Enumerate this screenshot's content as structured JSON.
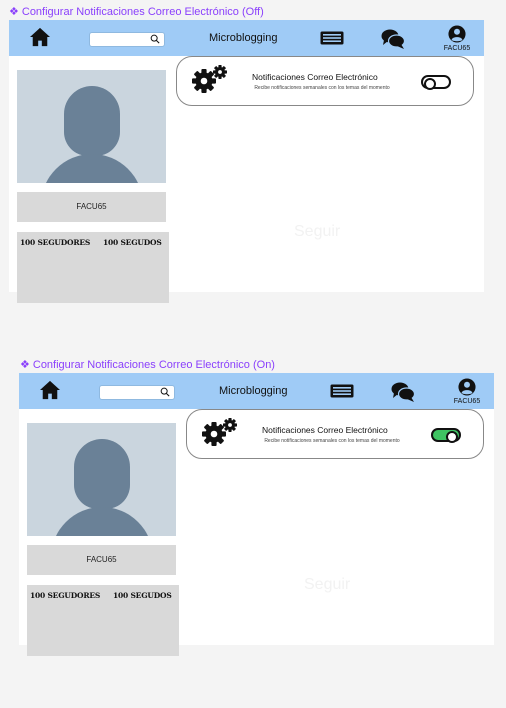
{
  "frames": [
    {
      "title": "Configurar Notificaciones Correo Electrónico (Off)",
      "app": {
        "search_placeholder": "",
        "brand": "Microblogging",
        "username": "FACU65"
      },
      "profile": {
        "username": "FACU65",
        "followers_label": "100 SEGUDORES",
        "following_label": "100 SEGUDOS",
        "follow_label": "Seguir"
      },
      "notification": {
        "title": "Notificaciones Correo Electrónico",
        "description": "Recibe notificaciones semanales con los temas del momento",
        "enabled": false
      }
    },
    {
      "title": "Configurar Notificaciones Correo Electrónico (On)",
      "app": {
        "search_placeholder": "",
        "brand": "Microblogging",
        "username": "FACU65"
      },
      "profile": {
        "username": "FACU65",
        "followers_label": "100 SEGUDORES",
        "following_label": "100 SEGUDOS",
        "follow_label": "Seguir"
      },
      "notification": {
        "title": "Notificaciones Correo Electrónico",
        "description": "Recibe notificaciones semanales con los temas del momento",
        "enabled": true
      }
    }
  ],
  "colors": {
    "frame_title": "#8a3ffc",
    "topbar": "#9fcbf6",
    "avatar_bg": "#cad5de",
    "avatar_fg": "#6a8197",
    "panel": "#d9d9d9",
    "toggle_on": "#3ec462"
  },
  "icons": [
    "home-icon",
    "search-icon",
    "feed-icon",
    "chat-icon",
    "user-icon",
    "gear-icon"
  ]
}
